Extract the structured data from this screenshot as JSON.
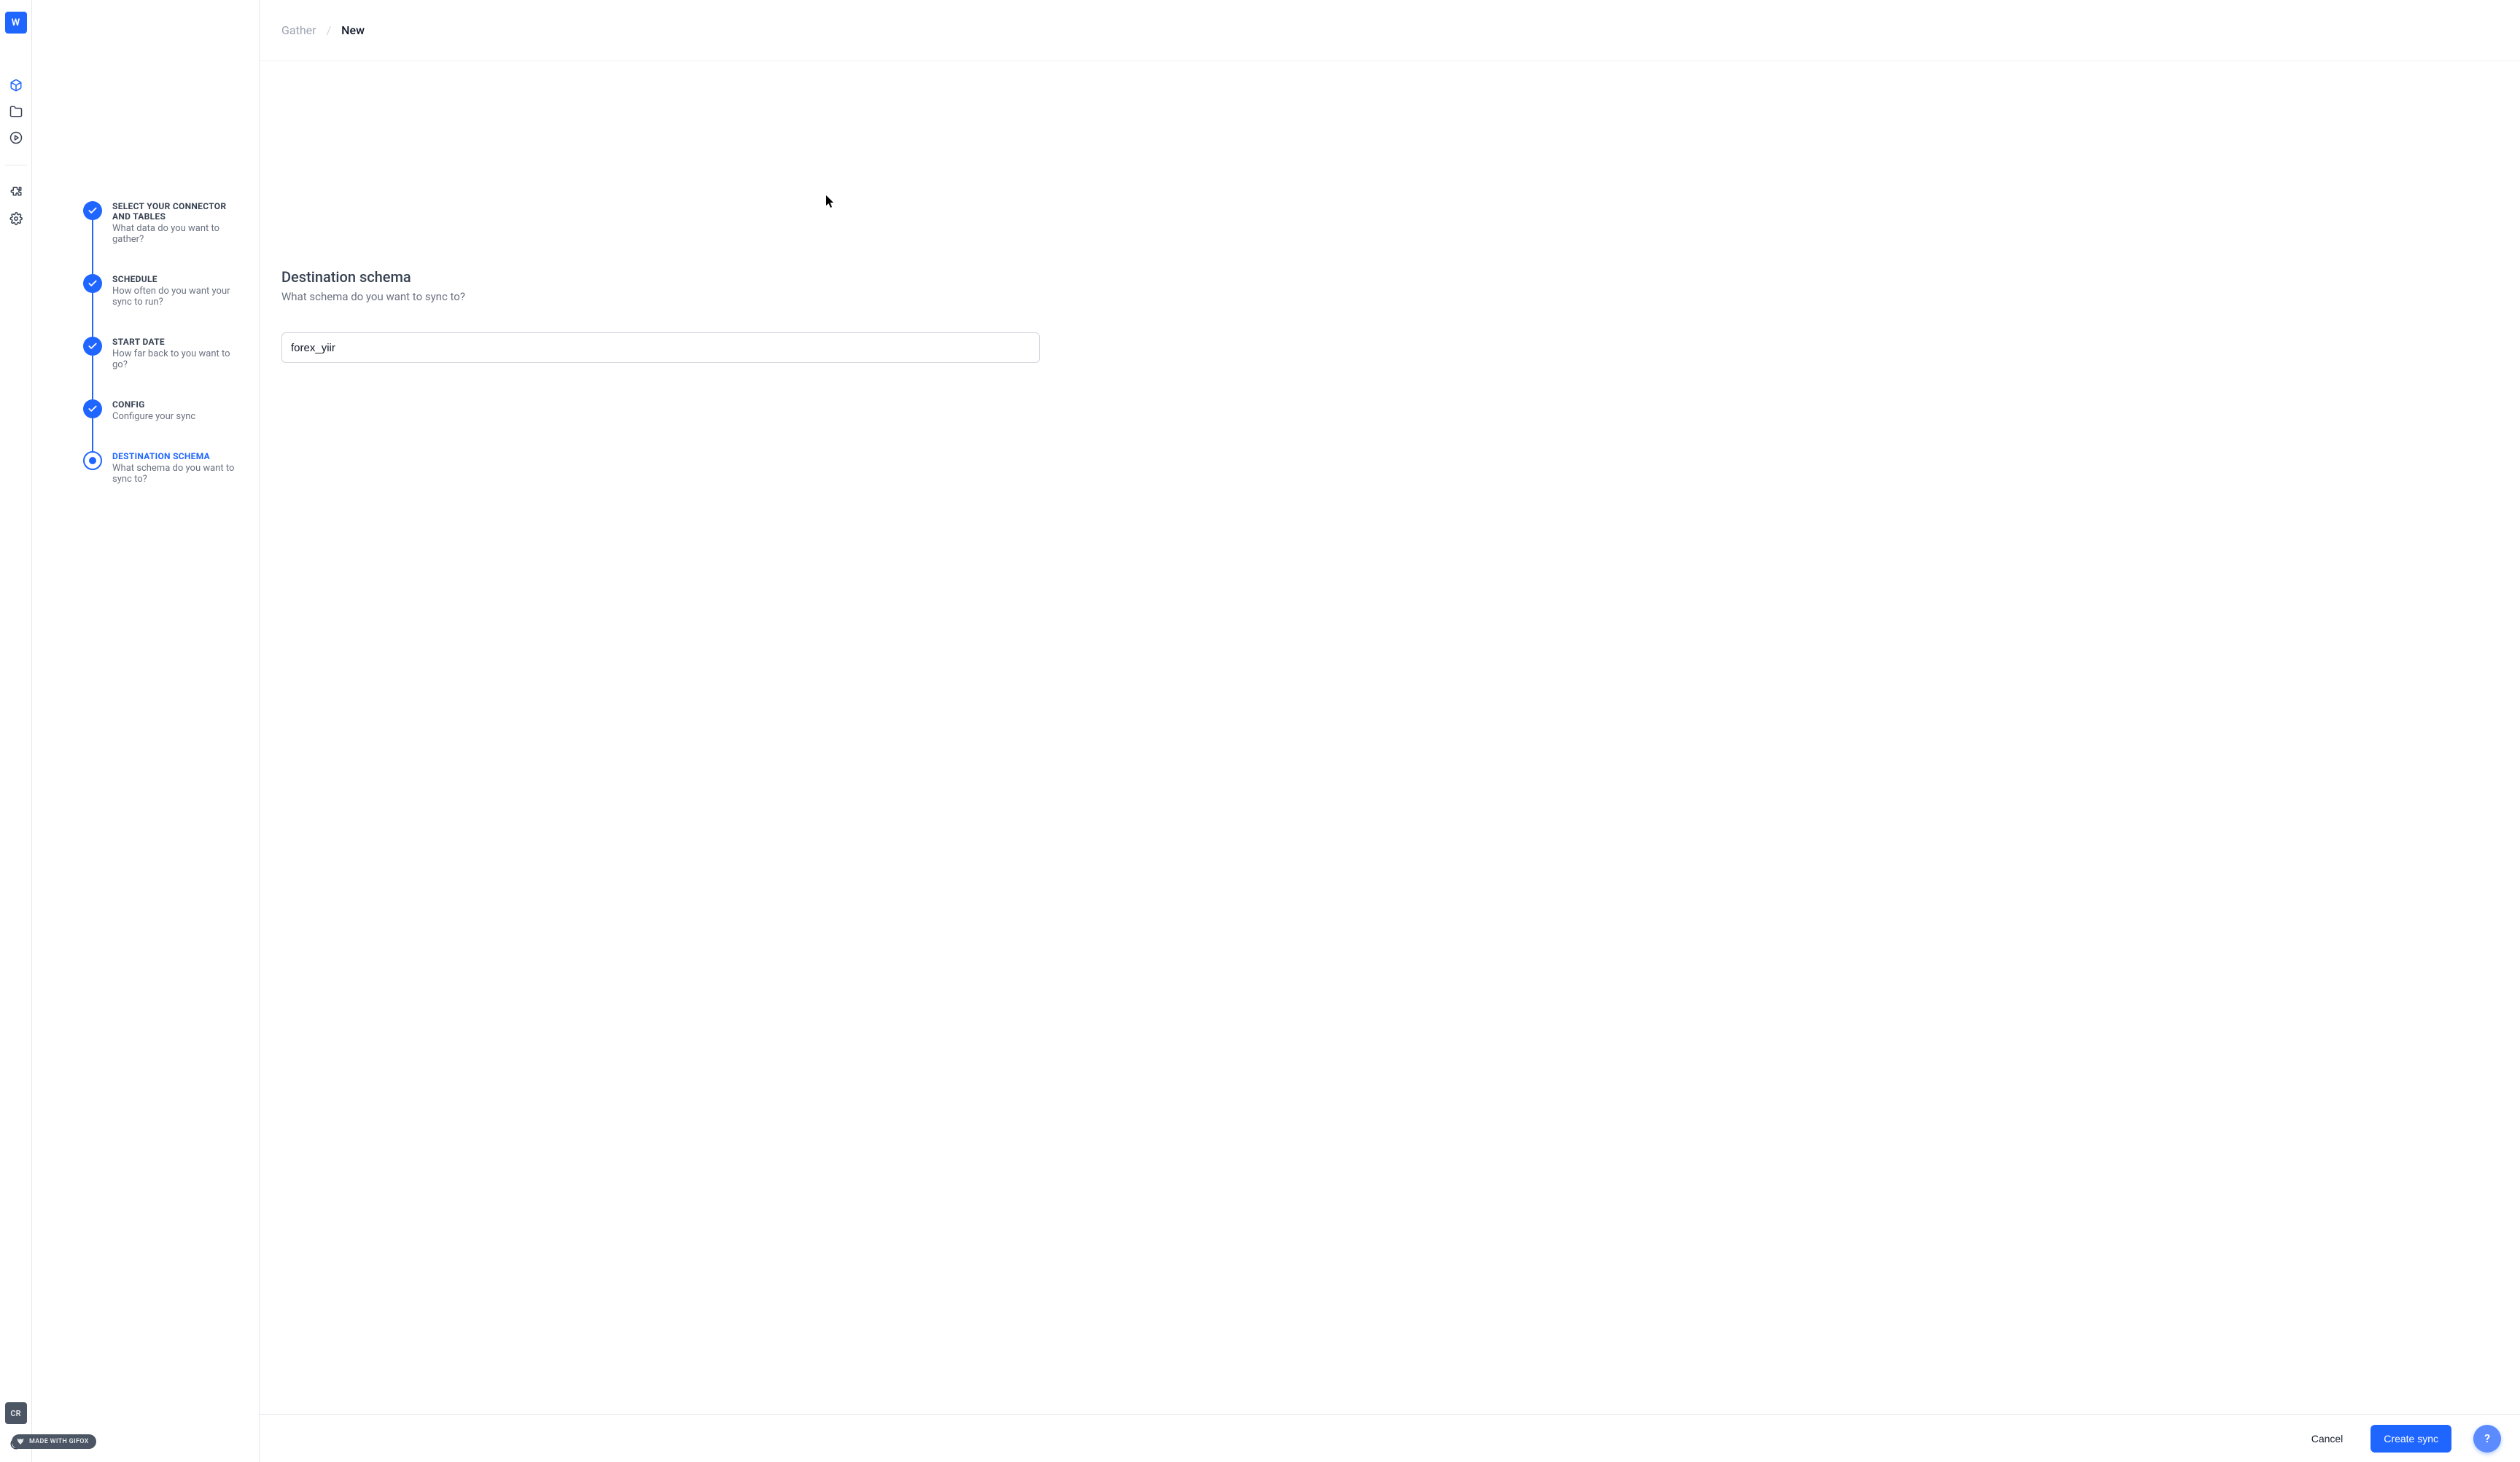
{
  "rail": {
    "logo_letter": "W",
    "user_initials": "CR",
    "icons": {
      "box": "box-icon",
      "folder": "folder-icon",
      "play": "play-circle-icon",
      "puzzle": "puzzle-icon",
      "gear": "gear-icon",
      "moon": "moon-icon"
    }
  },
  "breadcrumb": {
    "parent": "Gather",
    "current": "New",
    "sep": "/"
  },
  "stepper": {
    "items": [
      {
        "title": "SELECT YOUR CONNECTOR AND TABLES",
        "sub": "What data do you want to gather?",
        "state": "done"
      },
      {
        "title": "SCHEDULE",
        "sub": "How often do you want your sync to run?",
        "state": "done"
      },
      {
        "title": "START DATE",
        "sub": "How far back to you want to go?",
        "state": "done"
      },
      {
        "title": "CONFIG",
        "sub": "Configure your sync",
        "state": "done"
      },
      {
        "title": "DESTINATION SCHEMA",
        "sub": "What schema do you want to sync to?",
        "state": "current"
      }
    ]
  },
  "form": {
    "title": "Destination schema",
    "sub": "What schema do you want to sync to?",
    "value": "forex_yiir"
  },
  "footer": {
    "cancel": "Cancel",
    "submit": "Create sync",
    "help": "?"
  },
  "watermark": {
    "text": "MADE WITH GIFOX"
  }
}
